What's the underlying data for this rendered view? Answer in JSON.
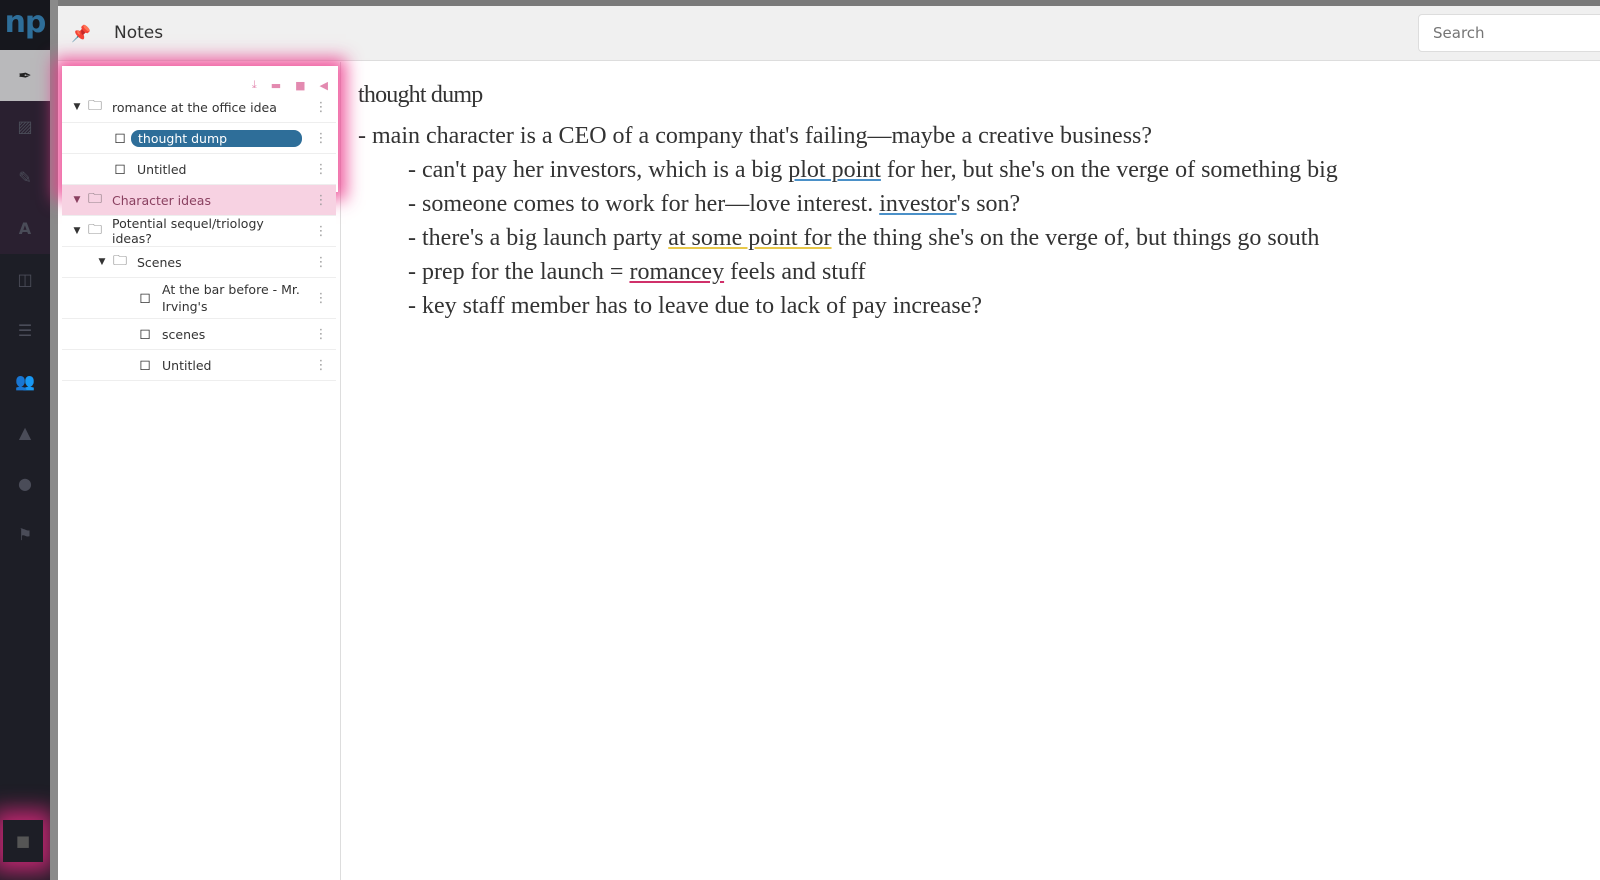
{
  "app": {
    "logo": "np",
    "title": "Notes"
  },
  "search": {
    "placeholder": "Search"
  },
  "rail": {
    "items": [
      "pen-nib",
      "no-image",
      "highlighter",
      "font",
      "layout",
      "signpost",
      "users",
      "map",
      "lightbulb",
      "flag"
    ],
    "bottom": "note"
  },
  "tree": [
    {
      "label": "romance at the office idea",
      "type": "folder",
      "depth": 0
    },
    {
      "label": "thought dump",
      "type": "note",
      "depth": 1,
      "selected": true
    },
    {
      "label": "Untitled",
      "type": "note",
      "depth": 1
    },
    {
      "label": "Character ideas",
      "type": "folder",
      "depth": 0
    },
    {
      "label": "Potential sequel/triology ideas?",
      "type": "folder",
      "depth": 0
    },
    {
      "label": "Scenes",
      "type": "folder",
      "depth": 1
    },
    {
      "label": "At the bar before - Mr. Irving's",
      "type": "note",
      "depth": 2
    },
    {
      "label": "scenes",
      "type": "note",
      "depth": 2
    },
    {
      "label": "Untitled",
      "type": "note",
      "depth": 2
    }
  ],
  "editor": {
    "title": "thought dump",
    "l1": "- main character is a CEO of a company that's failing—maybe a creative business?",
    "l2a": "- can't pay her investors, which is a big ",
    "l2b": "plot point",
    "l2c": " for her, but she's on the verge of something big",
    "l3a": "- someone comes to work for her—love interest. ",
    "l3b": "investor",
    "l3c": "'s son?",
    "l4a": "- there's a big launch party ",
    "l4b": "at some point for",
    "l4c": " the thing she's on the verge of, but things go south",
    "l5a": "- prep for the launch = ",
    "l5b": "romancey",
    "l5c": " feels and stuff",
    "l6": "- key staff member has to leave due to lack of pay increase?"
  },
  "colors": {
    "accent": "#2e6e99",
    "highlight": "#e8378a"
  }
}
